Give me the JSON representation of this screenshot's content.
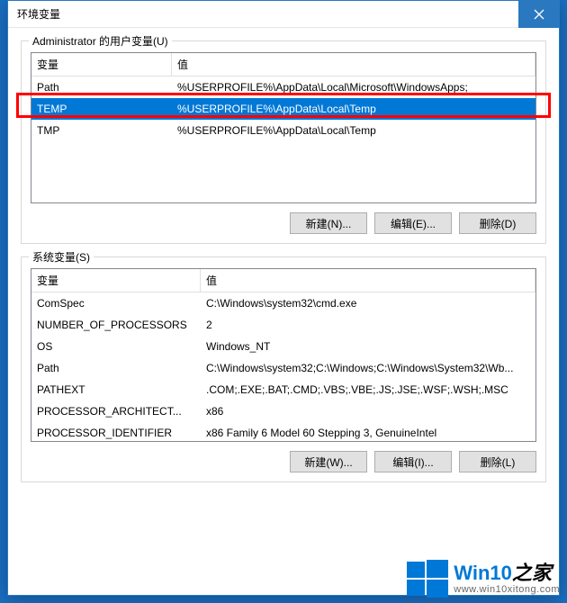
{
  "window": {
    "title": "环境变量"
  },
  "user_section": {
    "label": "Administrator 的用户变量(U)",
    "headers": {
      "var": "变量",
      "val": "值"
    },
    "rows": [
      {
        "var": "Path",
        "val": "%USERPROFILE%\\AppData\\Local\\Microsoft\\WindowsApps;",
        "selected": false
      },
      {
        "var": "TEMP",
        "val": "%USERPROFILE%\\AppData\\Local\\Temp",
        "selected": true
      },
      {
        "var": "TMP",
        "val": "%USERPROFILE%\\AppData\\Local\\Temp",
        "selected": false
      }
    ],
    "buttons": {
      "new": "新建(N)...",
      "edit": "编辑(E)...",
      "delete": "删除(D)"
    }
  },
  "system_section": {
    "label": "系统变量(S)",
    "headers": {
      "var": "变量",
      "val": "值"
    },
    "rows": [
      {
        "var": "ComSpec",
        "val": "C:\\Windows\\system32\\cmd.exe"
      },
      {
        "var": "NUMBER_OF_PROCESSORS",
        "val": "2"
      },
      {
        "var": "OS",
        "val": "Windows_NT"
      },
      {
        "var": "Path",
        "val": "C:\\Windows\\system32;C:\\Windows;C:\\Windows\\System32\\Wb..."
      },
      {
        "var": "PATHEXT",
        "val": ".COM;.EXE;.BAT;.CMD;.VBS;.VBE;.JS;.JSE;.WSF;.WSH;.MSC"
      },
      {
        "var": "PROCESSOR_ARCHITECT...",
        "val": "x86"
      },
      {
        "var": "PROCESSOR_IDENTIFIER",
        "val": "x86 Family 6 Model 60 Stepping 3, GenuineIntel"
      }
    ],
    "buttons": {
      "new": "新建(W)...",
      "edit": "编辑(I)...",
      "delete": "删除(L)"
    }
  },
  "watermark": {
    "brand_a": "Win10",
    "brand_b": "之家",
    "url": "www.win10xitong.com"
  }
}
